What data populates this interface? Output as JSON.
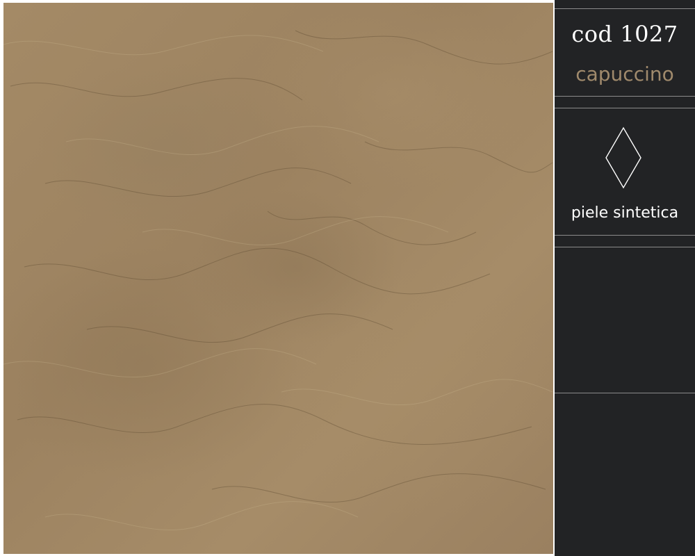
{
  "swatch": {
    "icon": "leather-texture",
    "color": "#a08662"
  },
  "info": {
    "code": "cod 1027",
    "color_name": "capuccino",
    "color_name_color": "#a08a6c",
    "material_icon": "diamond-icon",
    "material": "piele sintetica"
  }
}
